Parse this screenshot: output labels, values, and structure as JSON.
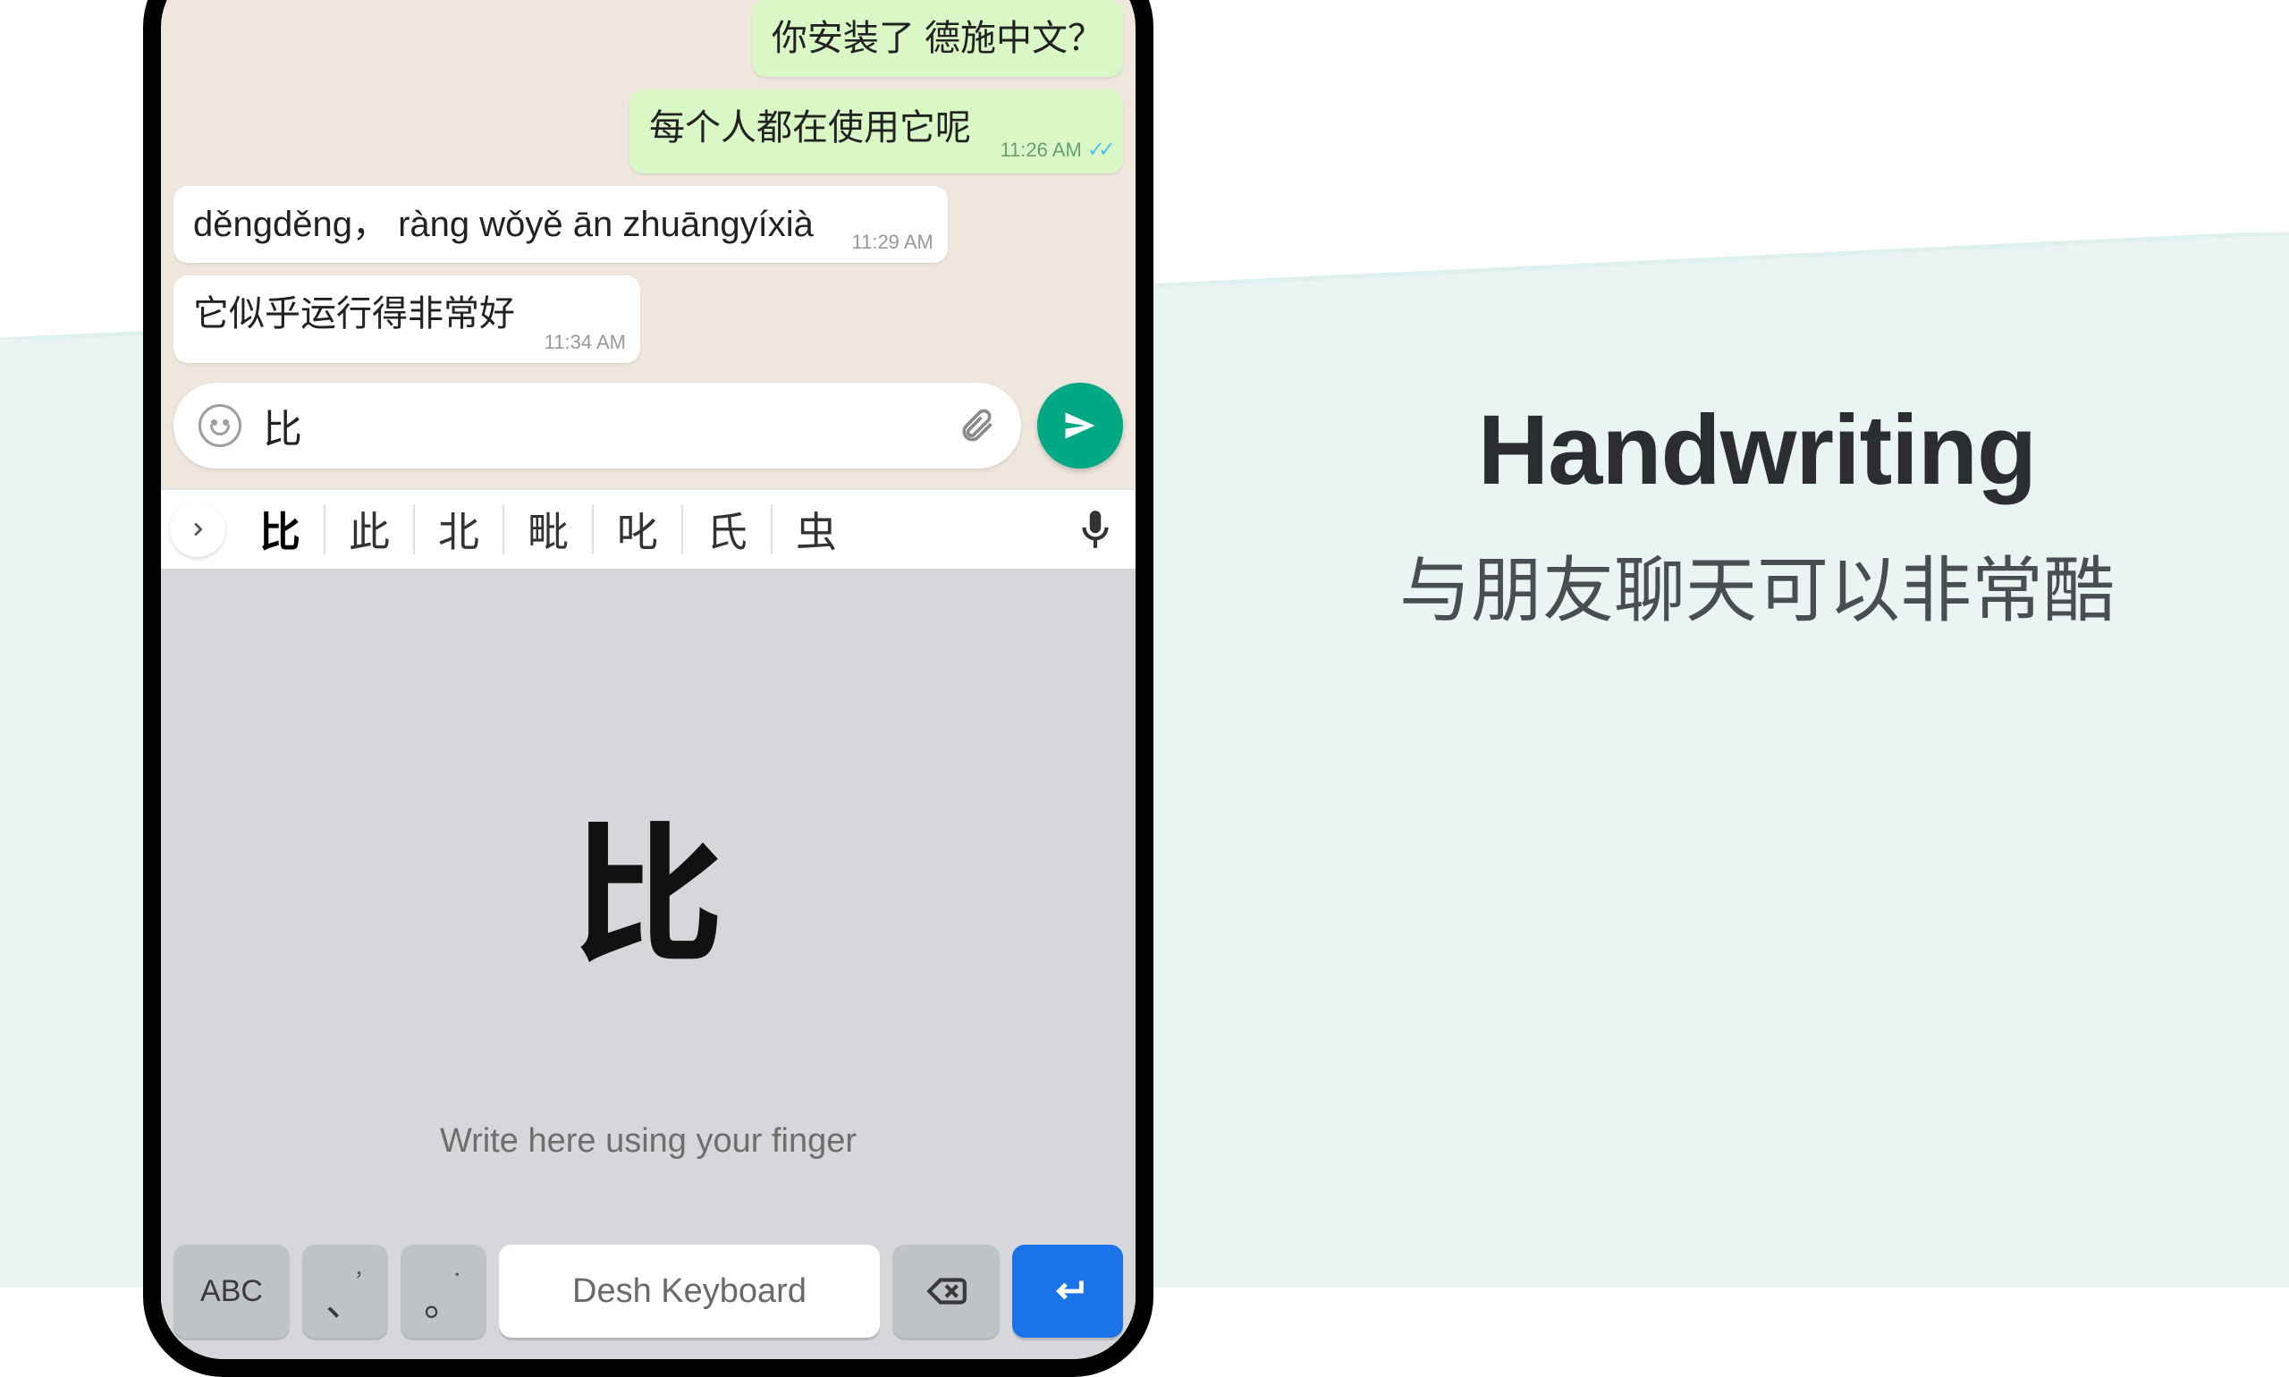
{
  "chat": {
    "sent1": {
      "text": "你安装了 德施中文？"
    },
    "sent2": {
      "text": "每个人都在使用它呢",
      "time": "11:26 AM"
    },
    "recv1": {
      "text": "děngděng， ràng wǒyě ān zhuāngyíxià",
      "time": "11:29 AM"
    },
    "recv2": {
      "text": "它似乎运行得非常好",
      "time": "11:34 AM"
    }
  },
  "composer": {
    "value": "比"
  },
  "candidates": [
    "比",
    "此",
    "北",
    "毗",
    "叱",
    "氏",
    "虫"
  ],
  "handwriting": {
    "char": "比",
    "hint": "Write here using your finger"
  },
  "bottom": {
    "abc": "ABC",
    "punct1_main": "、",
    "punct1_alt": "，",
    "punct2_main": "。",
    "punct2_alt": "．",
    "space": "Desh Keyboard"
  },
  "promo": {
    "title": "Handwriting",
    "subtitle": "与朋友聊天可以非常酷"
  }
}
